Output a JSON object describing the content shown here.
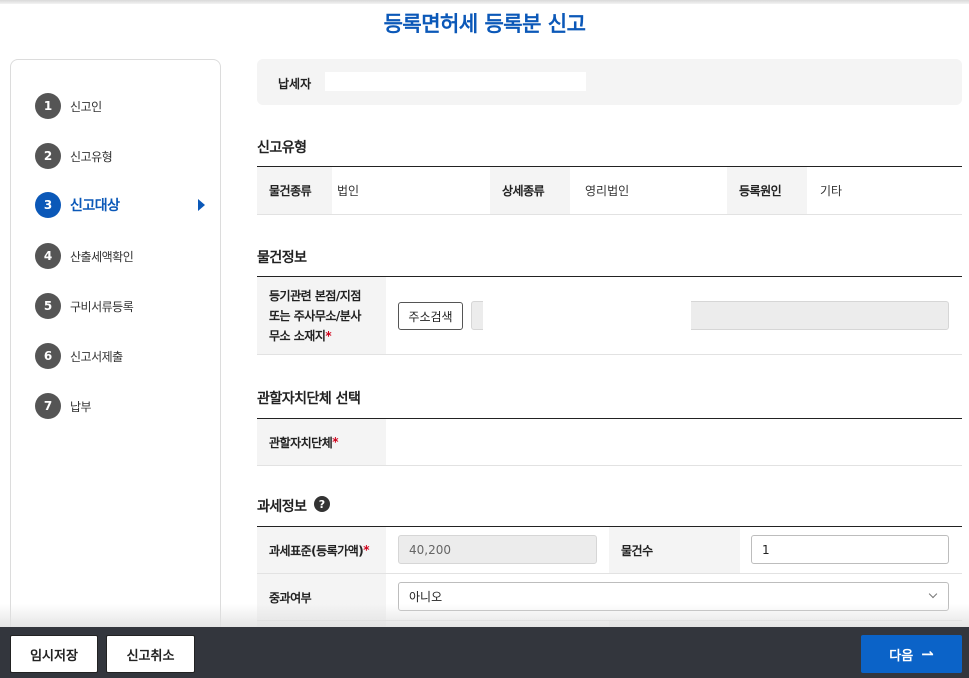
{
  "page_title": "등록면허세 등록분 신고",
  "steps": [
    {
      "num": "1",
      "label": "신고인"
    },
    {
      "num": "2",
      "label": "신고유형"
    },
    {
      "num": "3",
      "label": "신고대상"
    },
    {
      "num": "4",
      "label": "산출세액확인"
    },
    {
      "num": "5",
      "label": "구비서류등록"
    },
    {
      "num": "6",
      "label": "신고서제출"
    },
    {
      "num": "7",
      "label": "납부"
    }
  ],
  "active_step": 3,
  "taxpayer": {
    "label": "납세자",
    "value": ""
  },
  "report_type": {
    "title": "신고유형",
    "object_type_label": "물건종류",
    "object_type_value": "법인",
    "detail_type_label": "상세종류",
    "detail_type_value": "영리법인",
    "reg_reason_label": "등록원인",
    "reg_reason_value": "기타"
  },
  "object_info": {
    "title": "물건정보",
    "address_label_line1": "등기관련 본점/지점",
    "address_label_line2": "또는 주사무소/분사",
    "address_label_line3": "무소 소재지",
    "required_mark": "*",
    "address_search_button": "주소검색",
    "address_value": ""
  },
  "jurisdiction": {
    "title": "관할자치단체 선택",
    "label": "관할자치단체",
    "required_mark": "*"
  },
  "tax_info": {
    "title": "과세정보",
    "help_icon": "?",
    "tax_base_label": "과세표준(등록가액)",
    "required_mark": "*",
    "tax_base_value": "40,200",
    "item_count_label": "물건수",
    "item_count_value": "1",
    "heavy_tax_label": "중과여부",
    "heavy_tax_value": "아니오"
  },
  "bottom_bar": {
    "save_label": "임시저장",
    "cancel_label": "신고취소",
    "next_label": "다음",
    "next_arrow": "⇀"
  },
  "colors": {
    "accent": "#0b58b8",
    "next_button": "#0b63c8",
    "bottom_bar": "#33363d",
    "required": "#d0021b"
  }
}
